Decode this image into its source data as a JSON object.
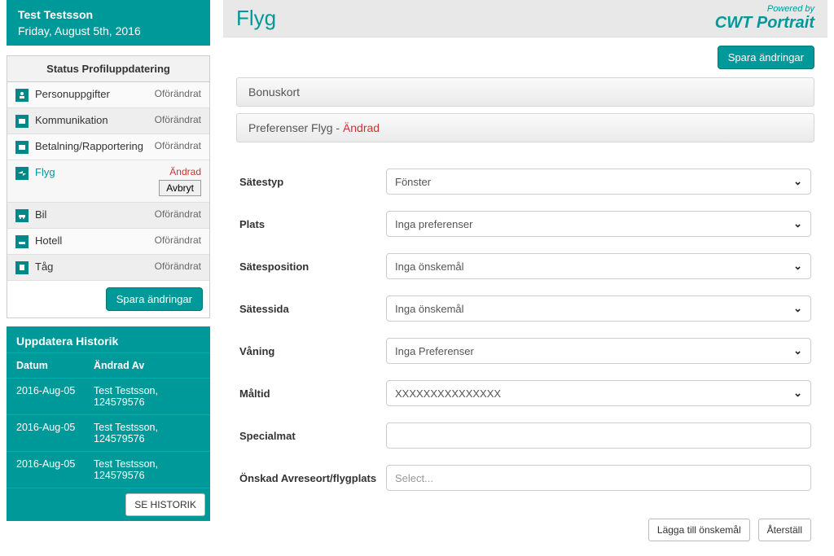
{
  "user": {
    "name": "Test Testsson",
    "date": "Friday, August 5th, 2016"
  },
  "status": {
    "title": "Status Profiluppdatering",
    "unchanged": "Oförändrat",
    "changed": "Ändrad",
    "cancel": "Avbryt",
    "items": [
      {
        "label": "Personuppgifter"
      },
      {
        "label": "Kommunikation"
      },
      {
        "label": "Betalning/Rapportering"
      },
      {
        "label": "Flyg"
      },
      {
        "label": "Bil"
      },
      {
        "label": "Hotell"
      },
      {
        "label": "Tåg"
      }
    ],
    "save": "Spara ändringar"
  },
  "history": {
    "title": "Uppdatera Historik",
    "col_date": "Datum",
    "col_by": "Ändrad Av",
    "rows": [
      {
        "date": "2016-Aug-05",
        "by": "Test Testsson, 124579576"
      },
      {
        "date": "2016-Aug-05",
        "by": "Test Testsson, 124579576"
      },
      {
        "date": "2016-Aug-05",
        "by": "Test Testsson, 124579576"
      }
    ],
    "button": "SE HISTORIK"
  },
  "page_title": "Flyg",
  "brand": {
    "powered": "Powered by",
    "name": "CWT Portrait"
  },
  "save_top": "Spara ändringar",
  "sections": {
    "bonuskort": "Bonuskort",
    "prefs_label": "Preferenser Flyg - ",
    "prefs_changed": "Ändrad"
  },
  "form": {
    "seattype": {
      "label": "Sätestyp",
      "value": "Fönster"
    },
    "plats": {
      "label": "Plats",
      "value": "Inga preferenser"
    },
    "seatpos": {
      "label": "Sätesposition",
      "value": "Inga önskemål"
    },
    "seatside": {
      "label": "Sätessida",
      "value": "Inga önskemål"
    },
    "floor": {
      "label": "Våning",
      "value": "Inga Preferenser"
    },
    "meal": {
      "label": "Måltid",
      "value": "XXXXXXXXXXXXXXX"
    },
    "specialmeal": {
      "label": "Specialmat",
      "value": ""
    },
    "departure": {
      "label": "Önskad Avreseort/flygplats",
      "placeholder": "Select..."
    }
  },
  "footer": {
    "add": "Lägga till önskemål",
    "reset": "Återställ"
  }
}
